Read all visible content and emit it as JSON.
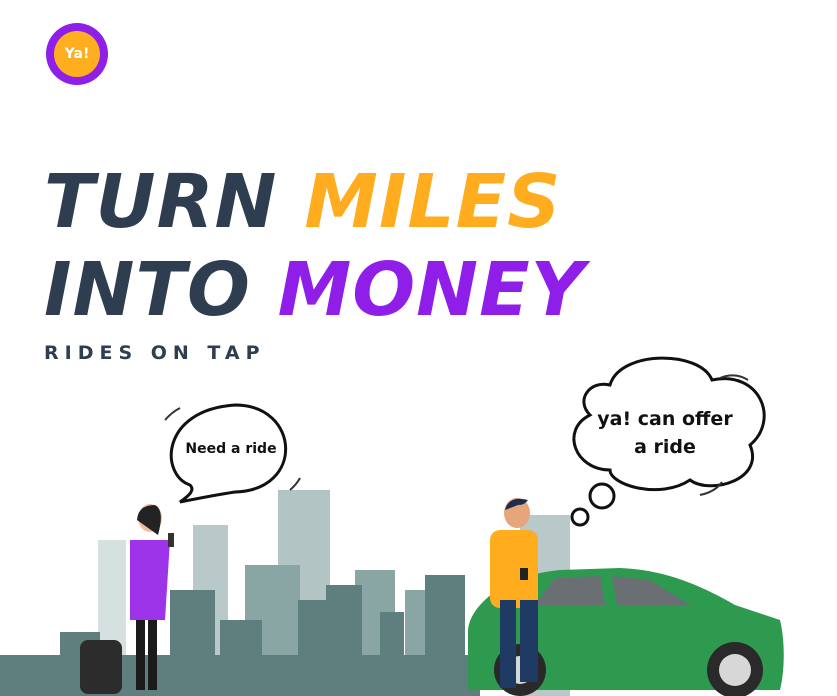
{
  "logo": {
    "text": "Ya!"
  },
  "headline": {
    "line1_dark": "TURN",
    "line1_accent": "MILES",
    "line2_dark": "INTO",
    "line2_accent": "MONEY"
  },
  "tagline": "RIDES ON TAP",
  "bubbles": {
    "passenger": "Need a ride",
    "driver_line1": "ya! can offer",
    "driver_line2": "a ride"
  },
  "colors": {
    "brand_purple": "#8f1fe8",
    "brand_orange": "#ffac1f",
    "dark_text": "#2f3d50",
    "car_green": "#2e9a4f"
  }
}
